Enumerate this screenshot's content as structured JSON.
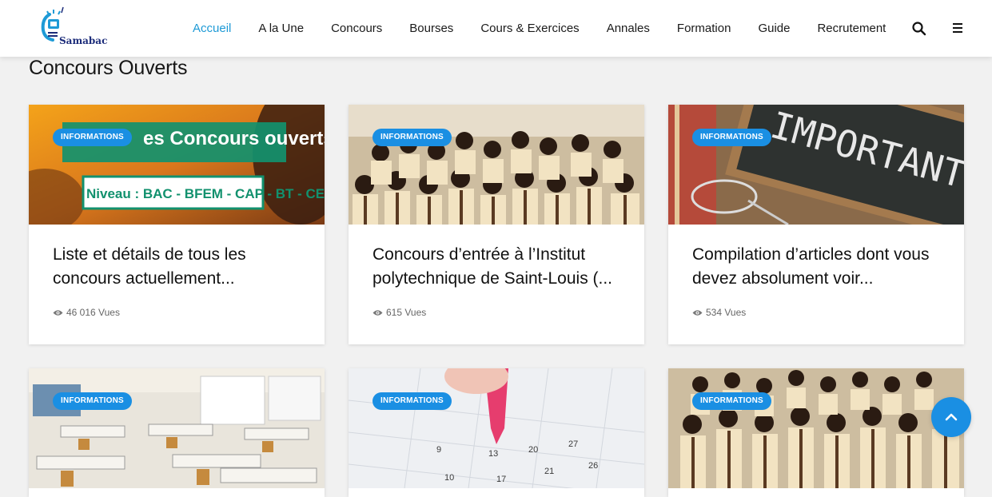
{
  "header": {
    "logo_text": "Samabac",
    "nav": [
      {
        "label": "Accueil",
        "active": true
      },
      {
        "label": "A la Une",
        "active": false
      },
      {
        "label": "Concours",
        "active": false
      },
      {
        "label": "Bourses",
        "active": false
      },
      {
        "label": "Cours & Exercices",
        "active": false
      },
      {
        "label": "Annales",
        "active": false
      },
      {
        "label": "Formation",
        "active": false
      },
      {
        "label": "Guide",
        "active": false
      },
      {
        "label": "Recrutement",
        "active": false
      }
    ],
    "icons": {
      "search": "search-icon",
      "menu": "hamburger-menu-icon"
    }
  },
  "section": {
    "title": "Concours Ouverts"
  },
  "cards": [
    {
      "badge": "INFORMATIONS",
      "title": "Liste et détails de tous les concours actuellement...",
      "views": "46 016 Vues",
      "image": {
        "banner_line1": "Liste des Concours ouverts",
        "banner_line2": "Niveau : BAC - BFEM - CAP - BT - CEP"
      }
    },
    {
      "badge": "INFORMATIONS",
      "title": "Concours d’entrée à l’Institut polytechnique de Saint-Louis (...",
      "views": "615 Vues",
      "image": {}
    },
    {
      "badge": "INFORMATIONS",
      "title": "Compilation d’articles dont vous devez absolument voir...",
      "views": "534 Vues",
      "image": {
        "chalkboard_text": "IMPORTANT"
      }
    },
    {
      "badge": "INFORMATIONS",
      "image": {}
    },
    {
      "badge": "INFORMATIONS",
      "image": {}
    },
    {
      "badge": "INFORMATIONS",
      "image": {}
    }
  ],
  "colors": {
    "accent": "#1a8fe3",
    "nav_active": "#1e9ad6"
  },
  "scroll_top": {
    "icon": "chevron-up-icon"
  }
}
